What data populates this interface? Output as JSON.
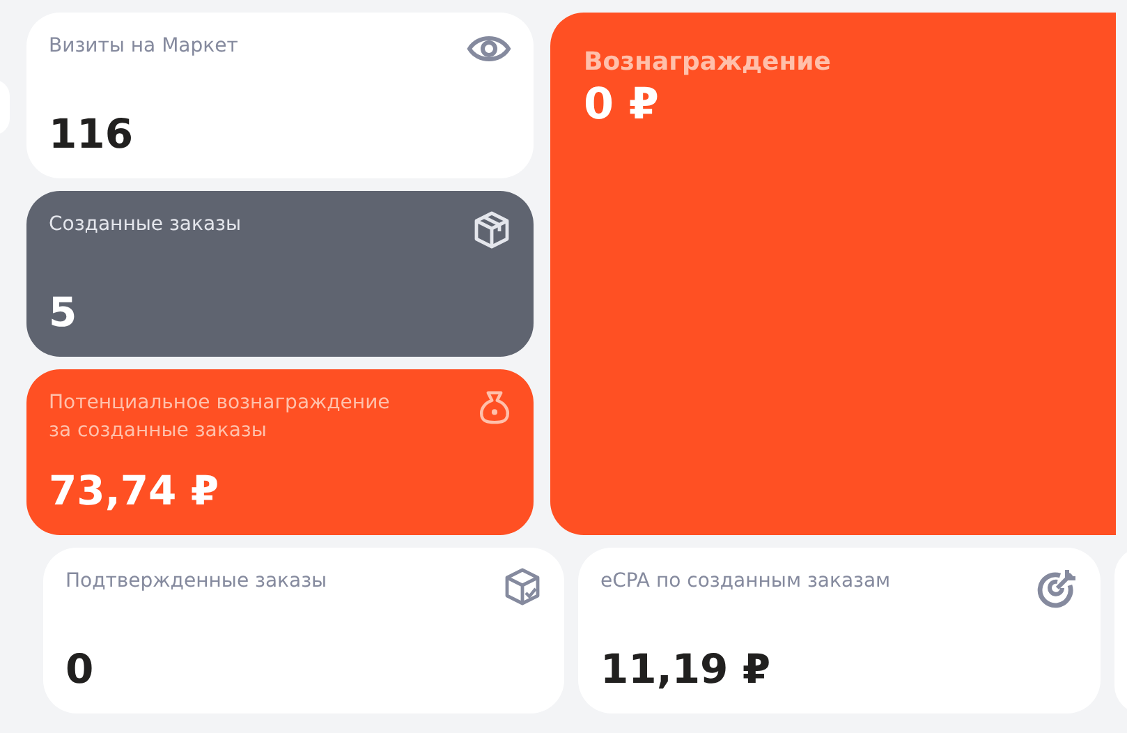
{
  "column_cards": [
    {
      "kind": "light",
      "label": "Визиты на Маркет",
      "value": "116"
    },
    {
      "kind": "dark",
      "label": "Созданные заказы",
      "value": "5"
    },
    {
      "kind": "accent",
      "label": "Потенциальное вознаграждение\nза созданные заказы",
      "value": "73,74 ₽"
    }
  ],
  "reward_card": {
    "kind": "accent",
    "label": "Вознаграждение",
    "value": "0 ₽"
  },
  "bottom_cards": [
    {
      "kind": "light",
      "label": "Подтвержденные заказы",
      "value": "0"
    },
    {
      "kind": "light",
      "label": "eCPA по созданным заказам",
      "value": "11,19 ₽"
    }
  ]
}
